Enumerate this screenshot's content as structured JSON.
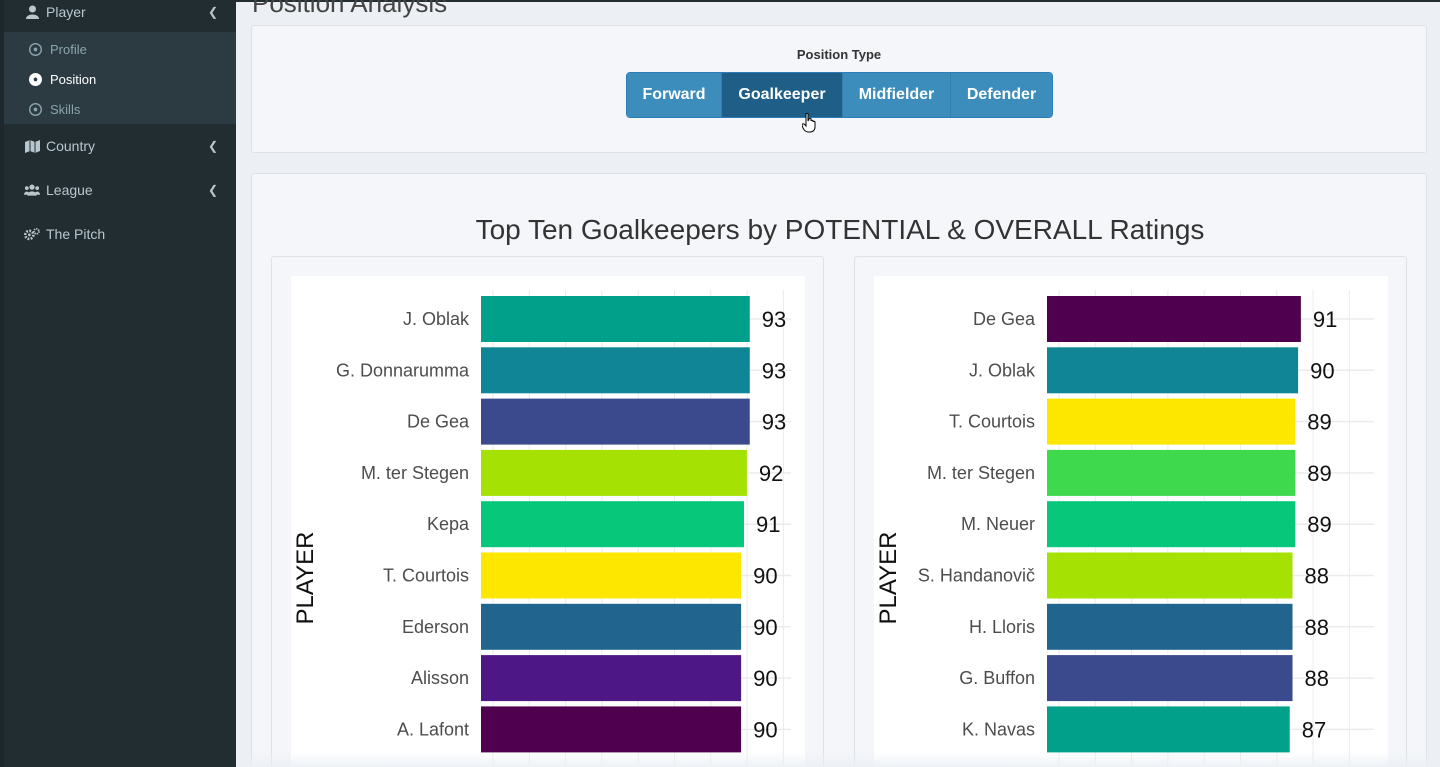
{
  "sidebar": {
    "player": {
      "label": "Player",
      "icon": "user-icon"
    },
    "sub_items": [
      {
        "label": "Profile",
        "icon": "soccer-ball-icon",
        "active": false
      },
      {
        "label": "Position",
        "icon": "soccer-ball-icon",
        "active": true
      },
      {
        "label": "Skills",
        "icon": "soccer-ball-icon",
        "active": false
      }
    ],
    "country": {
      "label": "Country",
      "icon": "map-icon"
    },
    "league": {
      "label": "League",
      "icon": "users-icon"
    },
    "pitch": {
      "label": "The Pitch",
      "icon": "cogs-icon"
    }
  },
  "main": {
    "page_title": "Position Analysis",
    "position_type_label": "Position Type",
    "buttons": [
      "Forward",
      "Goalkeeper",
      "Midfielder",
      "Defender"
    ],
    "active_button": "Goalkeeper",
    "chart_title": "Top Ten Goalkeepers by POTENTIAL & OVERALL Ratings"
  },
  "colors": {
    "sidebar_bg": "#222d32",
    "button": "#3c8dbc",
    "button_active": "#1f5f87"
  },
  "chart_data": [
    {
      "type": "bar",
      "orientation": "horizontal",
      "ylabel": "PLAYER",
      "categories": [
        "J. Oblak",
        "G. Donnarumma",
        "De Gea",
        "M. ter Stegen",
        "Kepa",
        "T. Courtois",
        "Ederson",
        "Alisson",
        "A. Lafont"
      ],
      "values": [
        93,
        93,
        93,
        92,
        91,
        90,
        90,
        90,
        90
      ],
      "colors": [
        "#00a08a",
        "#0f8595",
        "#3b4a8c",
        "#a5e203",
        "#07c77a",
        "#fde600",
        "#21658f",
        "#4d1885",
        "#4f004f"
      ],
      "grid": true
    },
    {
      "type": "bar",
      "orientation": "horizontal",
      "ylabel": "PLAYER",
      "categories": [
        "De Gea",
        "J. Oblak",
        "T. Courtois",
        "M. ter Stegen",
        "M. Neuer",
        "S. Handanovič",
        "H. Lloris",
        "G. Buffon",
        "K. Navas"
      ],
      "values": [
        91,
        90,
        89,
        89,
        89,
        88,
        88,
        88,
        87
      ],
      "colors": [
        "#4f004f",
        "#0f8595",
        "#fde600",
        "#3ed94c",
        "#07c77a",
        "#a5e203",
        "#21658f",
        "#3b4a8c",
        "#00a08a"
      ],
      "grid": true
    }
  ]
}
